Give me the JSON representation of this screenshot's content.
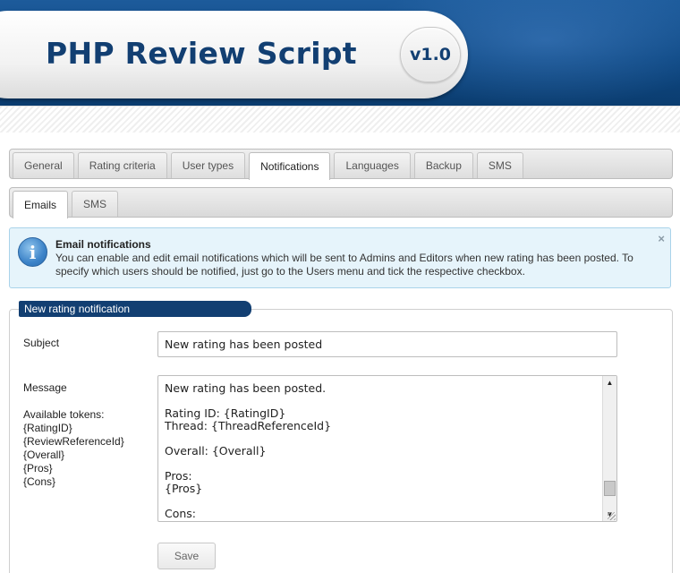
{
  "header": {
    "title": "PHP Review Script",
    "version": "v1.0"
  },
  "main_tabs": [
    {
      "label": "General",
      "active": false
    },
    {
      "label": "Rating criteria",
      "active": false
    },
    {
      "label": "User types",
      "active": false
    },
    {
      "label": "Notifications",
      "active": true
    },
    {
      "label": "Languages",
      "active": false
    },
    {
      "label": "Backup",
      "active": false
    },
    {
      "label": "SMS",
      "active": false
    }
  ],
  "sub_tabs": [
    {
      "label": "Emails",
      "active": true
    },
    {
      "label": "SMS",
      "active": false
    }
  ],
  "info": {
    "title": "Email notifications",
    "text": "You can enable and edit email notifications which will be sent to Admins and Editors when new rating has been posted. To specify which users should be notified, just go to the Users menu and tick the respective checkbox.",
    "close_glyph": "×"
  },
  "form": {
    "legend": "New rating notification",
    "subject_label": "Subject",
    "subject_value": "New rating has been posted",
    "message_label": "Message",
    "tokens_label": "Available tokens:",
    "tokens": [
      "{RatingID}",
      "{ReviewReferenceId}",
      "{Overall}",
      "{Pros}",
      "{Cons}"
    ],
    "message_value": "New rating has been posted.\n\nRating ID: {RatingID}\nThread: {ThreadReferenceId}\n\nOverall: {Overall}\n\nPros:\n{Pros}\n\nCons:",
    "save_label": "Save"
  },
  "colors": {
    "header_blue": "#0d4782",
    "brand_navy": "#123f72",
    "info_bg": "#e6f4fb",
    "info_border": "#a9d3ea"
  }
}
